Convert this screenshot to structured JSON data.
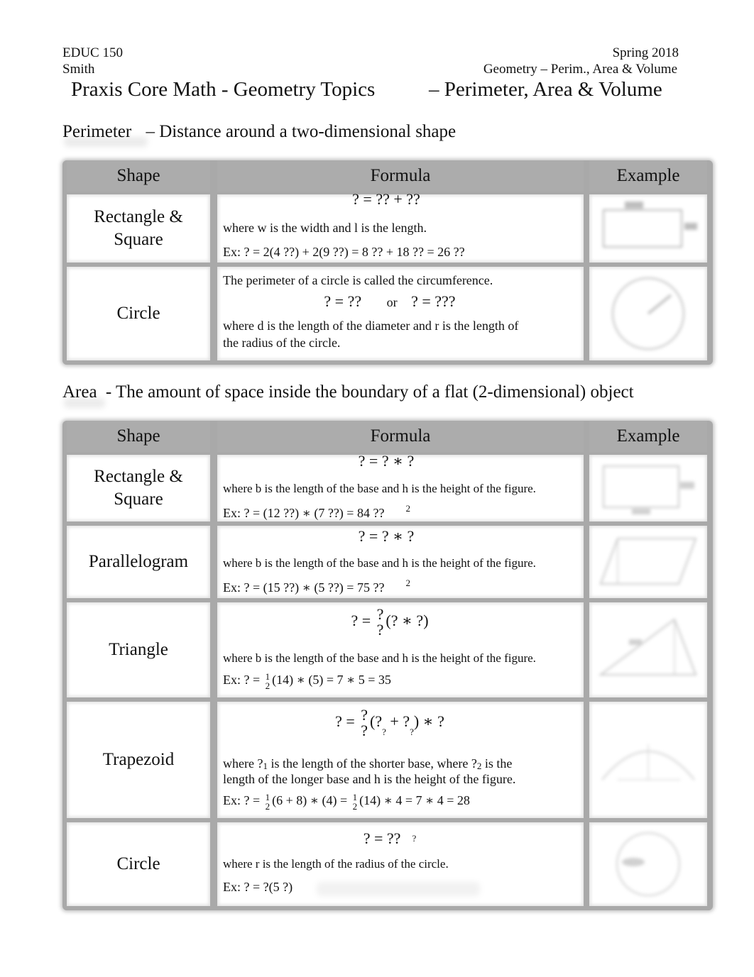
{
  "header": {
    "course": "EDUC 150",
    "instructor": "Smith",
    "term": "Spring 2018",
    "topic": "Geometry – Perim., Area & Volume",
    "title_left": "Praxis Core Math - Geometry Topics",
    "title_right": "– Perimeter, Area & Volume"
  },
  "perimeter": {
    "heading": "Perimeter",
    "definition": "– Distance around a two-dimensional shape",
    "columns": [
      "Shape",
      "Formula",
      "Example"
    ],
    "rows": [
      {
        "shape_line1": "Rectangle &",
        "shape_line2": "Square",
        "formula": "? = ?? + ??",
        "note": "where w is the width and l is the length.",
        "example": "Ex:  ? = 2(4 ??) + 2(9 ??) = 8 ?? + 18 ?? = 26 ??",
        "example_figure": "rectangle-sketch"
      },
      {
        "shape_line1": "Circle",
        "intro": "The perimeter of a circle is called the circumference.",
        "formula_a": "? = ??",
        "formula_or": "or",
        "formula_b": "? = ???",
        "note_line1": "where d is the length of the diameter and r is the length of",
        "note_line2": "the radius of the circle.",
        "example_figure": "circle-sketch"
      }
    ]
  },
  "area": {
    "heading": "Area",
    "definition": "- The amount of space inside the boundary of a flat (2-dimensional) object",
    "columns": [
      "Shape",
      "Formula",
      "Example"
    ],
    "rows": [
      {
        "shape_line1": "Rectangle &",
        "shape_line2": "Square",
        "formula": "? = ? ∗ ?",
        "note": "where b is the length of the base and h is the height of the figure.",
        "example": "Ex:  ? = (12 ??) ∗ (7 ??) = 84 ??",
        "example_sup": "2",
        "example_figure": "rectangle-sketch"
      },
      {
        "shape_line1": "Parallelogram",
        "formula": "? = ? ∗ ?",
        "note": "where b is the length of the base and h is the height of the figure.",
        "example": "Ex:  ? = (15 ??) ∗ (5 ??) = 75 ??",
        "example_sup": "2",
        "example_figure": "parallelogram-sketch"
      },
      {
        "shape_line1": "Triangle",
        "formula_lhs": "? =",
        "formula_frac_num": "?",
        "formula_frac_den": "?",
        "formula_rhs": "(? ∗ ?)",
        "note": "where b is the length of the base and h is the height of the figure.",
        "example_prefix": "Ex:  ? =",
        "example_frac_num": "1",
        "example_frac_den": "2",
        "example_rest": "(14) ∗ (5) = 7 ∗ 5 = 35",
        "example_figure": "triangle-sketch"
      },
      {
        "shape_line1": "Trapezoid",
        "formula_lhs": "? =",
        "formula_frac_num": "?",
        "formula_frac_den": "?",
        "formula_open": "(?",
        "formula_sub1": "?",
        "formula_plus": "+ ?",
        "formula_sub2": "?",
        "formula_close": ") ∗ ?",
        "note_a": "where ?",
        "note_sub1": "1",
        "note_b": " is the length of the shorter base, where ?",
        "note_sub2": "2",
        "note_c": " is the",
        "note_line2": "length of the longer base and h is the height of the figure.",
        "example_prefix": "Ex:  ? =",
        "example_frac1_num": "1",
        "example_frac1_den": "2",
        "example_mid": "(6 + 8) ∗ (4) =",
        "example_frac2_num": "1",
        "example_frac2_den": "2",
        "example_rest": "(14) ∗ 4 = 7 ∗ 4 = 28",
        "example_figure": "trapezoid-sketch"
      },
      {
        "shape_line1": "Circle",
        "formula": "? = ??",
        "formula_sup": "?",
        "note": "where r is the length of the radius of the circle.",
        "example": "Ex:  ? = ?(5 ?)",
        "example_figure": "circle-sketch"
      }
    ]
  }
}
